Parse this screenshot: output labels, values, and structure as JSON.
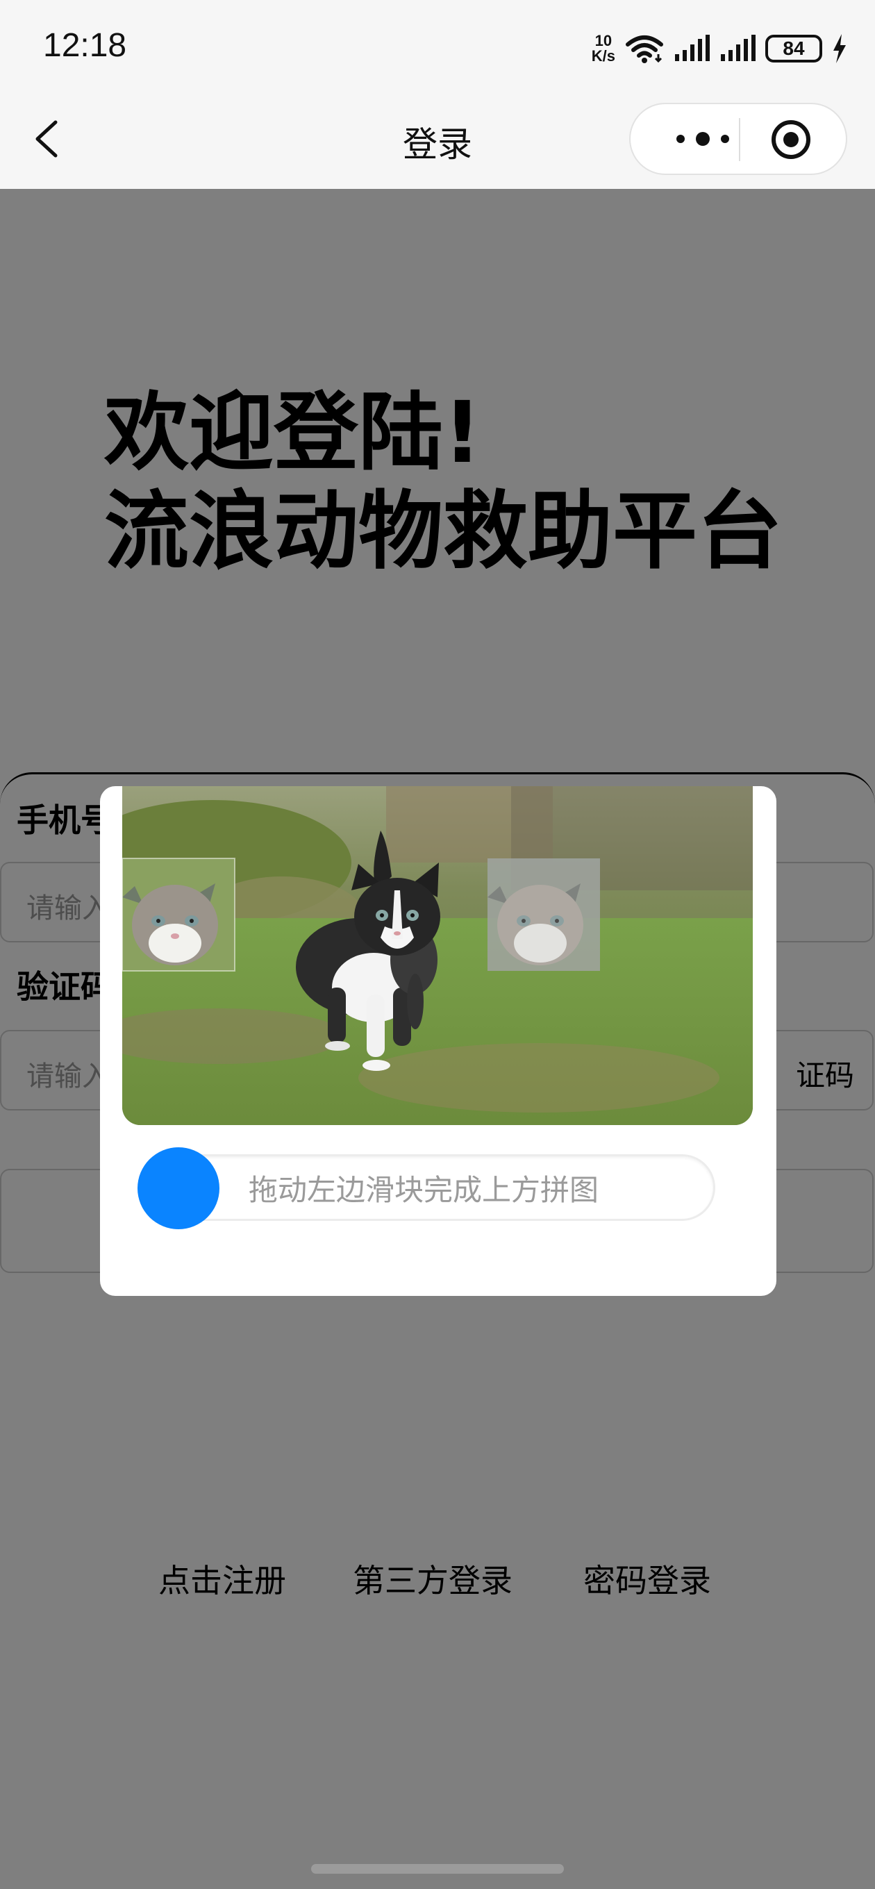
{
  "status_bar": {
    "time": "12:18",
    "speed_value": "10",
    "speed_unit": "K/s",
    "battery": "84",
    "icons": [
      "wifi-icon",
      "signal-icon",
      "signal-icon",
      "battery-icon",
      "charging-icon"
    ]
  },
  "nav": {
    "title": "登录",
    "back_icon": "chevron-left-icon",
    "more_icon": "more-dots-icon",
    "close_icon": "target-circle-icon"
  },
  "page": {
    "welcome_line1": "欢迎登陆!",
    "welcome_line2": "流浪动物救助平台",
    "phone_label": "手机号",
    "phone_placeholder": "请输入",
    "code_label": "验证码",
    "code_placeholder": "请输入",
    "get_code_label": "证码"
  },
  "bottom_links": {
    "register": "点击注册",
    "third_party": "第三方登录",
    "password_login": "密码登录"
  },
  "captcha": {
    "image": "kitten-photo",
    "slider_hint": "拖动左边滑块完成上方拼图",
    "accent_color": "#0a84ff"
  }
}
